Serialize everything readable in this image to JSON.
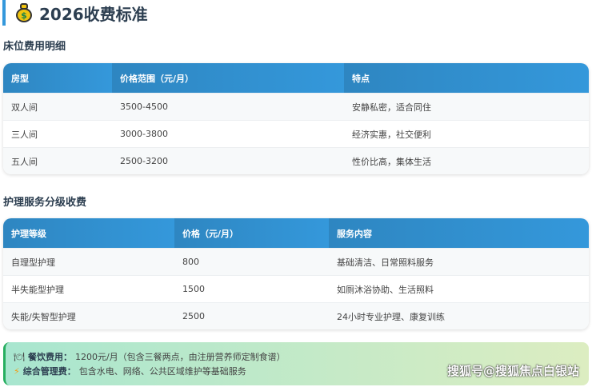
{
  "title": "2026收费标准",
  "bed": {
    "heading": "床位费用明细",
    "headers": [
      "房型",
      "价格范围（元/月）",
      "特点"
    ],
    "rows": [
      [
        "双人间",
        "3500-4500",
        "安静私密，适合同住"
      ],
      [
        "三人间",
        "3000-3800",
        "经济实惠，社交便利"
      ],
      [
        "五人间",
        "2500-3200",
        "性价比高，集体生活"
      ]
    ]
  },
  "care": {
    "heading": "护理服务分级收费",
    "headers": [
      "护理等级",
      "价格（元/月）",
      "服务内容"
    ],
    "rows": [
      [
        "自理型护理",
        "800",
        "基础清洁、日常照料服务"
      ],
      [
        "半失能型护理",
        "1500",
        "如厕沐浴协助、生活照料"
      ],
      [
        "失能/失智型护理",
        "2500",
        "24小时专业护理、康复训练"
      ]
    ]
  },
  "notes": [
    {
      "label": "餐饮费用：",
      "text": "1200元/月（包含三餐两点，由注册营养师定制食谱）"
    },
    {
      "label": "综合管理费：",
      "text": "包含水电、网络、公共区域维护等基础服务"
    }
  ],
  "watermark": "搜狐号@搜狐焦点白银站"
}
